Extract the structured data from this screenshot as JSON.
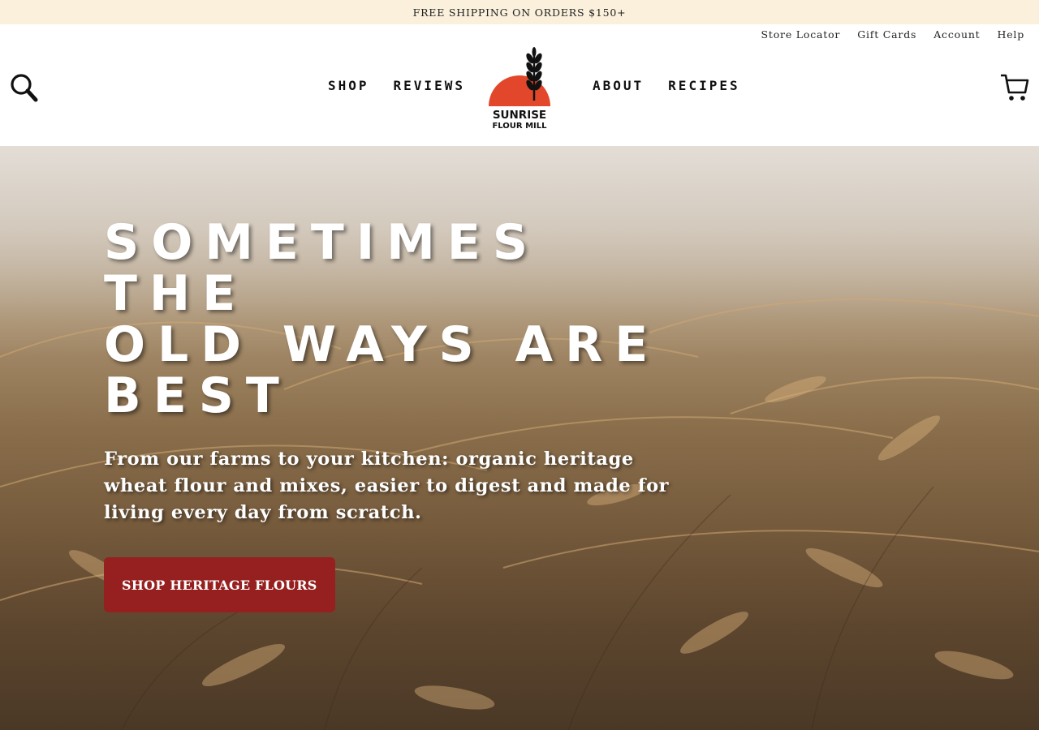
{
  "announcement": "FREE SHIPPING ON ORDERS $150+",
  "utility_nav": [
    "Store Locator",
    "Gift Cards",
    "Account",
    "Help"
  ],
  "nav_left": [
    "SHOP",
    "REVIEWS"
  ],
  "nav_right": [
    "ABOUT",
    "RECIPES"
  ],
  "logo": {
    "line1": "SUNRISE",
    "line2": "FLOUR MILL",
    "sun_color": "#e2472b"
  },
  "hero": {
    "headline_lines": [
      "SOMETIMES THE",
      "OLD WAYS ARE",
      "BEST"
    ],
    "subtext": "From our farms to your kitchen: organic heritage wheat flour and mixes, easier to digest and made for living every day from scratch.",
    "cta_label": "SHOP HERITAGE FLOURS",
    "cta_color": "#962020"
  },
  "icons": {
    "search": "search-icon",
    "cart": "cart-icon",
    "wheat": "wheat-icon"
  }
}
